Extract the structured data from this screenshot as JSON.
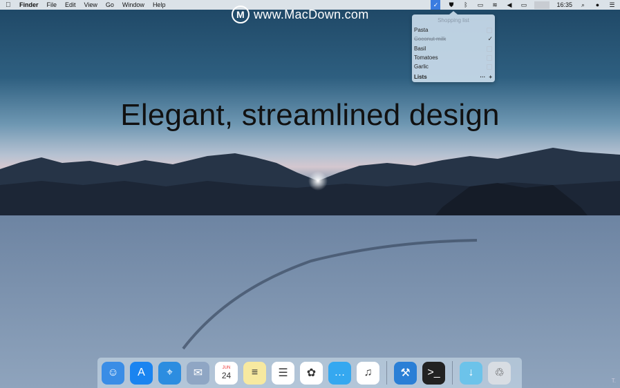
{
  "menubar": {
    "apple": "",
    "items": [
      {
        "label": "Finder",
        "bold": true
      },
      {
        "label": "File"
      },
      {
        "label": "Edit"
      },
      {
        "label": "View"
      },
      {
        "label": "Go"
      },
      {
        "label": "Window"
      },
      {
        "label": "Help"
      }
    ],
    "clock": "16:35",
    "status_icons": [
      "checkmark-icon",
      "shield-icon",
      "bluetooth-icon",
      "airplay-icon",
      "wifi-icon",
      "volume-icon",
      "battery-icon",
      "user-icon",
      "search-icon",
      "siri-icon",
      "notification-center-icon"
    ]
  },
  "watermark": {
    "logo": "M",
    "text": "www.MacDown.com"
  },
  "popover": {
    "title": "Shopping list",
    "items": [
      {
        "label": "Pasta",
        "done": false
      },
      {
        "label": "Coconut milk",
        "done": true
      },
      {
        "label": "Basil",
        "done": false
      },
      {
        "label": "Tomatoes",
        "done": false
      },
      {
        "label": "Garlic",
        "done": false
      }
    ],
    "footer_label": "Lists",
    "more": "···",
    "add": "+"
  },
  "headline": "Elegant, streamlined design",
  "dock": {
    "apps": [
      {
        "name": "finder-icon",
        "glyph": "☺",
        "color": "#3a8de6"
      },
      {
        "name": "app-store-icon",
        "glyph": "A",
        "color": "#1a84f0"
      },
      {
        "name": "safari-icon",
        "glyph": "⌖",
        "color": "#2c8de0"
      },
      {
        "name": "mail-icon",
        "glyph": "✉",
        "color": "#8fa6c4"
      },
      {
        "name": "calendar-icon",
        "glyph": "24",
        "color": "#ffffff",
        "sub": "JUN"
      },
      {
        "name": "notes-icon",
        "glyph": "≡",
        "color": "#f7e9a0"
      },
      {
        "name": "reminders-icon",
        "glyph": "☰",
        "color": "#ffffff"
      },
      {
        "name": "photos-icon",
        "glyph": "✿",
        "color": "#ffffff"
      },
      {
        "name": "messages-icon",
        "glyph": "…",
        "color": "#35a8f0"
      },
      {
        "name": "itunes-icon",
        "glyph": "♫",
        "color": "#ffffff"
      }
    ],
    "apps2": [
      {
        "name": "xcode-icon",
        "glyph": "⚒",
        "color": "#2a7fd6"
      },
      {
        "name": "terminal-icon",
        "glyph": ">_",
        "color": "#222222"
      }
    ],
    "apps3": [
      {
        "name": "downloads-folder-icon",
        "glyph": "↓",
        "color": "#6cc3ea"
      },
      {
        "name": "trash-icon",
        "glyph": "♲",
        "color": "#d8dde3"
      }
    ]
  },
  "corner_text": "T."
}
